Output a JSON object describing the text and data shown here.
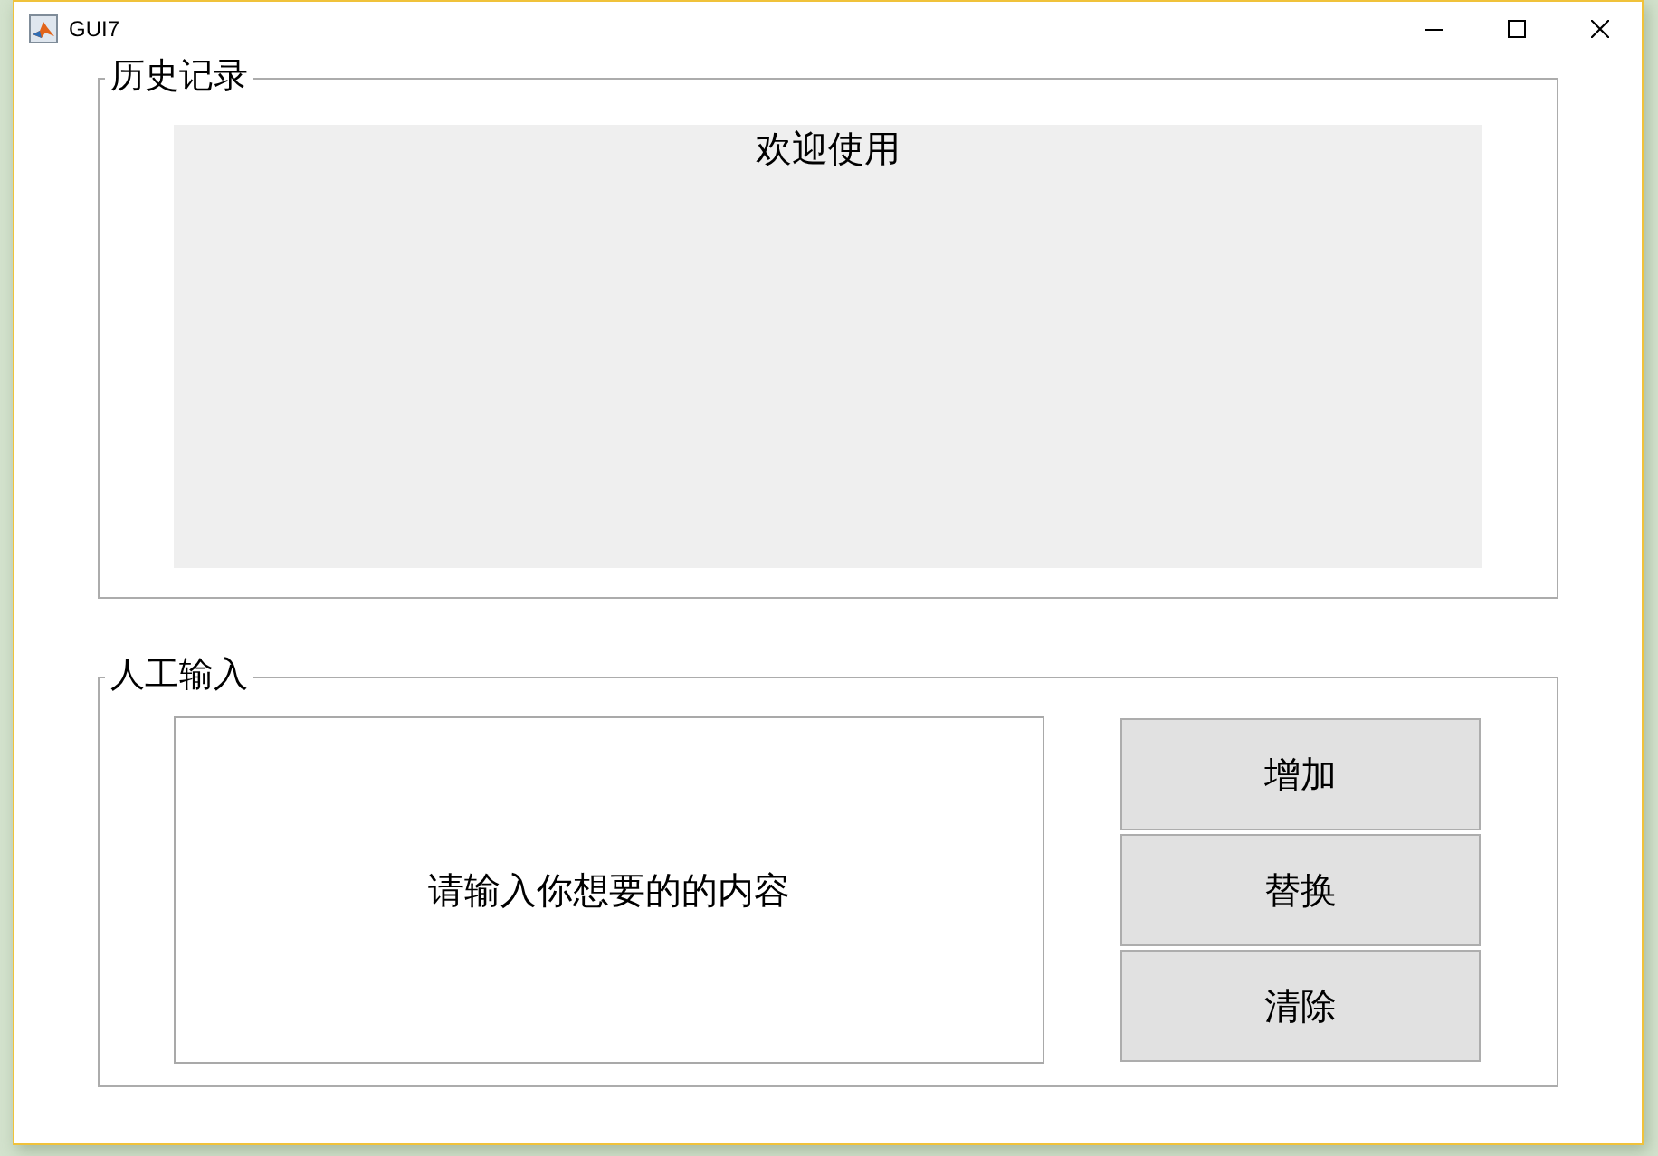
{
  "window": {
    "title": "GUI7",
    "controls": [
      {
        "kind": "minimize"
      },
      {
        "kind": "maximize"
      },
      {
        "kind": "close"
      }
    ]
  },
  "history_panel": {
    "title": "历史记录",
    "display_text": "欢迎使用"
  },
  "input_panel": {
    "title": "人工输入",
    "input": {
      "value": "请输入你想要的的内容"
    },
    "buttons": [
      {
        "label": "增加"
      },
      {
        "label": "替换"
      },
      {
        "label": "清除"
      }
    ]
  }
}
